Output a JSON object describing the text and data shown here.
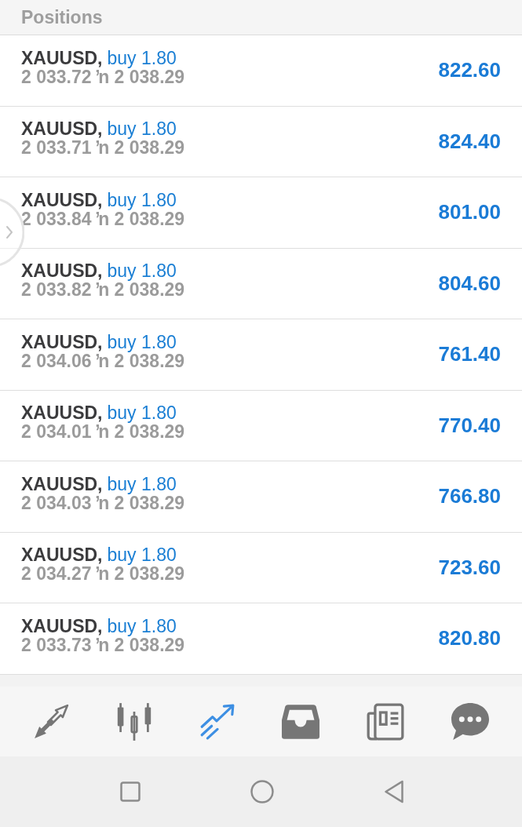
{
  "header": {
    "title": "Positions"
  },
  "positions": [
    {
      "symbol": "XAUUSD,",
      "side": "buy 1.80",
      "prices": "2 033.72 ŉ 2 038.29",
      "profit": "822.60"
    },
    {
      "symbol": "XAUUSD,",
      "side": "buy 1.80",
      "prices": "2 033.71 ŉ 2 038.29",
      "profit": "824.40"
    },
    {
      "symbol": "XAUUSD,",
      "side": "buy 1.80",
      "prices": "2 033.84 ŉ 2 038.29",
      "profit": "801.00"
    },
    {
      "symbol": "XAUUSD,",
      "side": "buy 1.80",
      "prices": "2 033.82 ŉ 2 038.29",
      "profit": "804.60"
    },
    {
      "symbol": "XAUUSD,",
      "side": "buy 1.80",
      "prices": "2 034.06 ŉ 2 038.29",
      "profit": "761.40"
    },
    {
      "symbol": "XAUUSD,",
      "side": "buy 1.80",
      "prices": "2 034.01 ŉ 2 038.29",
      "profit": "770.40"
    },
    {
      "symbol": "XAUUSD,",
      "side": "buy 1.80",
      "prices": "2 034.03 ŉ 2 038.29",
      "profit": "766.80"
    },
    {
      "symbol": "XAUUSD,",
      "side": "buy 1.80",
      "prices": "2 034.27 ŉ 2 038.29",
      "profit": "723.60"
    },
    {
      "symbol": "XAUUSD,",
      "side": "buy 1.80",
      "prices": "2 033.73 ŉ 2 038.29",
      "profit": "820.80"
    }
  ],
  "bottom_tabs": [
    {
      "selected": false
    },
    {
      "selected": false
    },
    {
      "selected": true
    },
    {
      "selected": false
    },
    {
      "selected": false
    },
    {
      "selected": false
    }
  ]
}
